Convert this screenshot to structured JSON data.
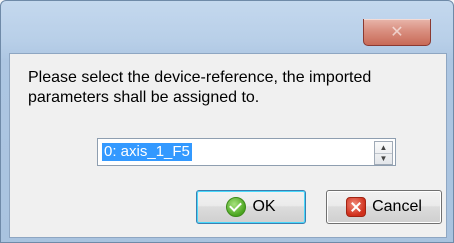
{
  "window": {
    "close_glyph": "✕"
  },
  "dialog": {
    "message": "Please select the device-reference, the imported parameters shall be assigned to.",
    "reference_value": "0: axis_1_F5",
    "stepper_up": "▲",
    "stepper_down": "▼"
  },
  "buttons": {
    "ok_label": "OK",
    "cancel_label": "Cancel"
  },
  "icons": {
    "ok": "check-circle-icon",
    "cancel": "x-square-icon"
  },
  "colors": {
    "selection": "#3399ff",
    "close_button": "#d98f80",
    "ok_icon": "#4aa51f",
    "cancel_icon": "#d0301c"
  }
}
